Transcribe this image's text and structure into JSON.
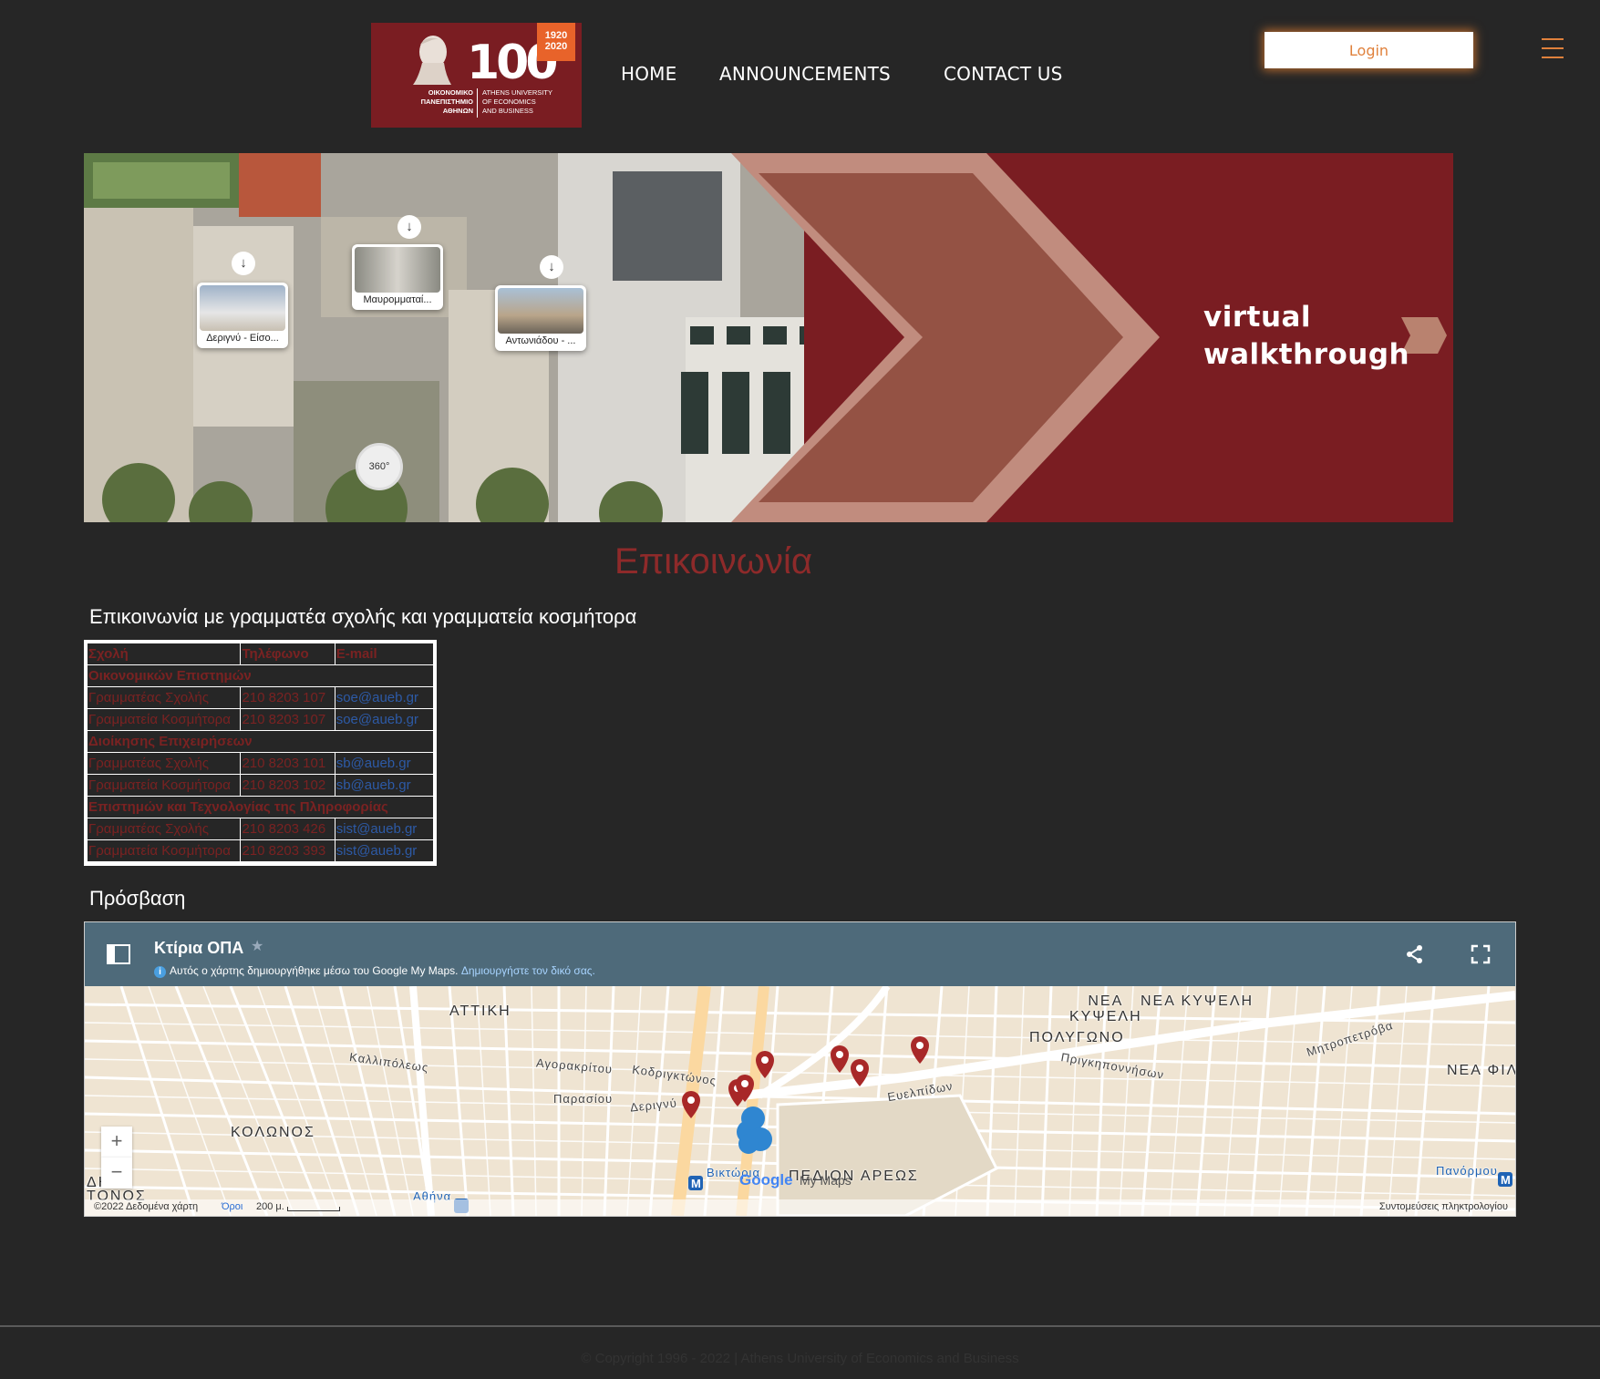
{
  "header": {
    "logo": {
      "hundred": "100",
      "years": "1920\n2020",
      "greek_name": "ΟΙΚΟΝΟΜΙΚΟ\nΠΑΝΕΠΙΣΤΗΜΙΟ\nΑΘΗΝΩΝ",
      "english_name": "ATHENS UNIVERSITY\nOF ECONOMICS\nAND BUSINESS"
    },
    "nav": [
      {
        "label": "HOME"
      },
      {
        "label": "ANNOUNCEMENTS"
      },
      {
        "label": "CONTACT US"
      }
    ],
    "login_label": "Login",
    "accent_color": "#e0813c",
    "menu_icon": "hamburger-icon"
  },
  "banner": {
    "text_line1": "virtual",
    "text_line2": "walkthrough",
    "hotspots": [
      {
        "caption": "Δεριγνύ - Είσο..."
      },
      {
        "caption": "Μαυρομματαί..."
      },
      {
        "caption": "Αντωνιάδου - ..."
      }
    ],
    "badge_360": "360°",
    "brand_color": "#7a1d22"
  },
  "page": {
    "title": "Επικοινωνία",
    "subheading": "Επικοινωνία με γραμματέα σχολής και γραμματεία κοσμήτορα",
    "access_heading": "Πρόσβαση"
  },
  "contacts": {
    "headers": [
      "Σχολή",
      "Τηλέφωνο",
      "E-mail"
    ],
    "sections": [
      {
        "name": "Οικονομικών Επιστημών",
        "rows": [
          {
            "role": "Γραμματέας Σχολής",
            "phone": "210 8203 107",
            "email": "soe@aueb.gr"
          },
          {
            "role": "Γραμματεία Κοσμήτορα",
            "phone": "210 8203 107",
            "email": "soe@aueb.gr"
          }
        ]
      },
      {
        "name": "Διοίκησης Επιχειρήσεων",
        "rows": [
          {
            "role": "Γραμματέας Σχολής",
            "phone": "210 8203 101",
            "email": "sb@aueb.gr"
          },
          {
            "role": "Γραμματεία Κοσμήτορα",
            "phone": "210 8203 102",
            "email": "sb@aueb.gr"
          }
        ]
      },
      {
        "name": "Επιστημών και Τεχνολογίας της Πληροφορίας",
        "rows": [
          {
            "role": "Γραμματέας Σχολής",
            "phone": "210 8203 426",
            "email": "sist@aueb.gr"
          },
          {
            "role": "Γραμματεία Κοσμήτορα",
            "phone": "210 8203 393",
            "email": "sist@aueb.gr"
          }
        ]
      }
    ]
  },
  "map": {
    "title": "Κτίρια ΟΠΑ",
    "note": "Αυτός ο χάρτης δημιουργήθηκε μέσω του Google My Maps.",
    "note_link": "Δημιουργήστε τον δικό σας.",
    "zoom_in": "+",
    "zoom_out": "−",
    "footer_data": "©2022 Δεδομένα χάρτη",
    "footer_terms": "Όροι",
    "footer_scale": "200 μ.",
    "footer_shortcuts": "Συντομεύσεις πληκτρολογίου",
    "google_logo": "Google",
    "my_maps": "My Maps",
    "labels": {
      "attiki": "ΑΤΤΙΚΗ",
      "kolonos": "ΚΟΛΩΝΟΣ",
      "pedion_areos": "ΠΕΔΙΟΝ ΑΡΕΩΣ",
      "nea_kypseli": "ΝΕΑ ΚΥΨΕΛΗ",
      "nea_kypseli_2": "ΝΕΑ\nΚΥΨΕΛΗ",
      "polygono": "ΠΟΛΥΓΩΝΟ",
      "nea_fil": "ΝΕΑ ΦΙΛ",
      "kallirois": "Καλλιπόλεως",
      "agorakritou": "Αγορακρίτου",
      "kodrigktonos": "Κοδριγκτώνος",
      "paraskevis": "Παρασίου",
      "deriny": "Δεριγνύ",
      "evelpidon": "Ευελπίδων",
      "prigkiponnison": "Πριγκηποννήσων",
      "mitropetrova": "Μητροπετρόβα",
      "viktoria": "Βικτώρια",
      "athina": "Αθήνα",
      "panormou": "Πανόρμου",
      "dimotos": "ΔΗ\nΤΟΝΟΣ"
    },
    "marker_color": "#a82828",
    "header_color": "#4e6a7a"
  },
  "footer": {
    "copyright": "© Copyright 1996 - 2022 | Athens University of Economics and Business"
  }
}
